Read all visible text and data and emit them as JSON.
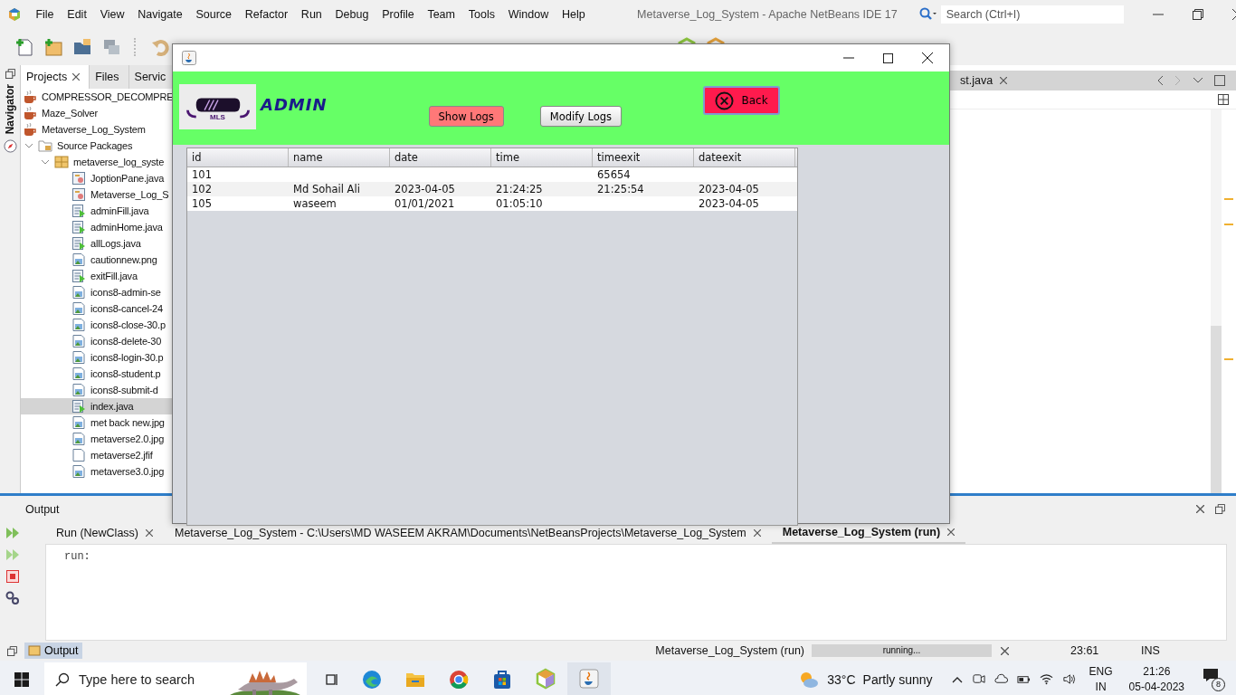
{
  "ide": {
    "title": "Metaverse_Log_System - Apache NetBeans IDE 17",
    "menu": [
      "File",
      "Edit",
      "View",
      "Navigate",
      "Source",
      "Refactor",
      "Run",
      "Debug",
      "Profile",
      "Team",
      "Tools",
      "Window",
      "Help"
    ],
    "search": {
      "placeholder": "Search (Ctrl+I)"
    }
  },
  "project_tabs": [
    {
      "label": "Projects",
      "selected": true
    },
    {
      "label": "Files",
      "selected": false
    },
    {
      "label": "Servic",
      "selected": false
    }
  ],
  "navigator_label": "Navigator",
  "project_tree": [
    {
      "label": "COMPRESSOR_DECOMPRE",
      "kind": "project",
      "selected": false
    },
    {
      "label": "Maze_Solver",
      "kind": "project",
      "selected": false
    },
    {
      "label": "Metaverse_Log_System",
      "kind": "project",
      "selected": false,
      "children": [
        {
          "label": "Source Packages",
          "kind": "folder",
          "selected": false,
          "expanded": true,
          "children": [
            {
              "label": "metaverse_log_syste",
              "kind": "package",
              "selected": false,
              "expanded": true,
              "children": [
                {
                  "label": "JoptionPane.java",
                  "kind": "form",
                  "selected": false
                },
                {
                  "label": "Metaverse_Log_S",
                  "kind": "form",
                  "selected": false
                },
                {
                  "label": "adminFill.java",
                  "kind": "java",
                  "selected": false
                },
                {
                  "label": "adminHome.java",
                  "kind": "java",
                  "selected": false
                },
                {
                  "label": "allLogs.java",
                  "kind": "java",
                  "selected": false
                },
                {
                  "label": "cautionnew.png",
                  "kind": "image",
                  "selected": false
                },
                {
                  "label": "exitFill.java",
                  "kind": "java",
                  "selected": false
                },
                {
                  "label": "icons8-admin-se",
                  "kind": "image",
                  "selected": false
                },
                {
                  "label": "icons8-cancel-24",
                  "kind": "image",
                  "selected": false
                },
                {
                  "label": "icons8-close-30.p",
                  "kind": "image",
                  "selected": false
                },
                {
                  "label": "icons8-delete-30",
                  "kind": "image",
                  "selected": false
                },
                {
                  "label": "icons8-login-30.p",
                  "kind": "image",
                  "selected": false
                },
                {
                  "label": "icons8-student.p",
                  "kind": "image",
                  "selected": false
                },
                {
                  "label": "icons8-submit-d",
                  "kind": "image",
                  "selected": false
                },
                {
                  "label": "index.java",
                  "kind": "java",
                  "selected": true
                },
                {
                  "label": "met back new.jpg",
                  "kind": "image",
                  "selected": false
                },
                {
                  "label": "metaverse2.0.jpg",
                  "kind": "image",
                  "selected": false
                },
                {
                  "label": "metaverse2.jfif",
                  "kind": "file",
                  "selected": false
                },
                {
                  "label": "metaverse3.0.jpg",
                  "kind": "image",
                  "selected": false
                }
              ]
            }
          ]
        }
      ]
    }
  ],
  "editor_tab": {
    "label": "st.java"
  },
  "output": {
    "title": "Output",
    "tabs": [
      {
        "label": "Run (NewClass)",
        "selected": false
      },
      {
        "label": "Metaverse_Log_System - C:\\Users\\MD WASEEM AKRAM\\Documents\\NetBeansProjects\\Metaverse_Log_System",
        "selected": false
      },
      {
        "label": "Metaverse_Log_System (run)",
        "selected": true
      }
    ],
    "console": "run:"
  },
  "status_bar": {
    "output_button": "Output",
    "task": "Metaverse_Log_System (run)",
    "progress": "running...",
    "level": 1,
    "position": "23:61",
    "mode": "INS"
  },
  "taskbar": {
    "search_placeholder": "Type here to search",
    "temperature": "33°C",
    "weather": "Partly sunny",
    "language": "ENG",
    "region": "IN",
    "time": "21:26",
    "date": "05-04-2023",
    "notifications": "8"
  },
  "dialog": {
    "logo_text": "MLS",
    "title": "ADMIN",
    "buttons": [
      {
        "label": "Show Logs",
        "selected": true
      },
      {
        "label": "Modify Logs",
        "selected": false
      }
    ],
    "back": "Back",
    "table": {
      "columns": [
        "id",
        "name",
        "date",
        "time",
        "timeexit",
        "dateexit"
      ],
      "rows": [
        {
          "cells": [
            "101",
            null,
            null,
            null,
            "65654",
            null
          ]
        },
        {
          "cells": [
            "102",
            "Md Sohail Ali",
            "2023-04-05",
            "21:24:25",
            "21:25:54",
            "2023-04-05"
          ]
        },
        {
          "cells": [
            "105",
            "waseem",
            "01/01/2021",
            "01:05:10",
            null,
            "2023-04-05"
          ]
        }
      ]
    }
  }
}
